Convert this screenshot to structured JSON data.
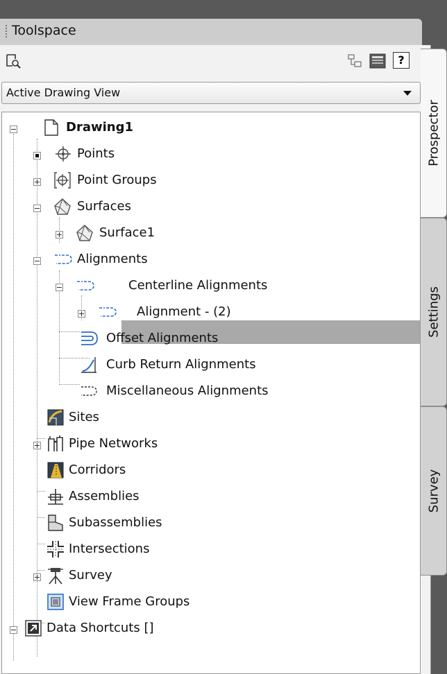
{
  "window": {
    "title": "Toolspace"
  },
  "toolbar": {
    "icons": [
      "item-view-icon",
      "panel-layout-icon",
      "event-viewer-icon",
      "help-icon"
    ],
    "help_glyph": "?"
  },
  "view_selector": {
    "selected": "Active Drawing View"
  },
  "tree": {
    "drawing": "Drawing1",
    "points": "Points",
    "point_groups": "Point Groups",
    "surfaces": "Surfaces",
    "surface1": "Surface1",
    "alignments": "Alignments",
    "centerline_alignments": "Centerline Alignments",
    "alignment_2": "Alignment - (2)",
    "offset_alignments": "Offset Alignments",
    "curb_return_alignments": "Curb Return Alignments",
    "misc_alignments": "Miscellaneous Alignments",
    "sites": "Sites",
    "pipe_networks": "Pipe Networks",
    "corridors": "Corridors",
    "assemblies": "Assemblies",
    "subassemblies": "Subassemblies",
    "intersections": "Intersections",
    "survey": "Survey",
    "view_frame_groups": "View Frame Groups",
    "data_shortcuts": "Data Shortcuts []"
  },
  "tabs": {
    "prospector": "Prospector",
    "settings": "Settings",
    "survey": "Survey"
  },
  "colors": {
    "selection": "#a9a9a9",
    "alignment_blue": "#2a6fc9"
  }
}
